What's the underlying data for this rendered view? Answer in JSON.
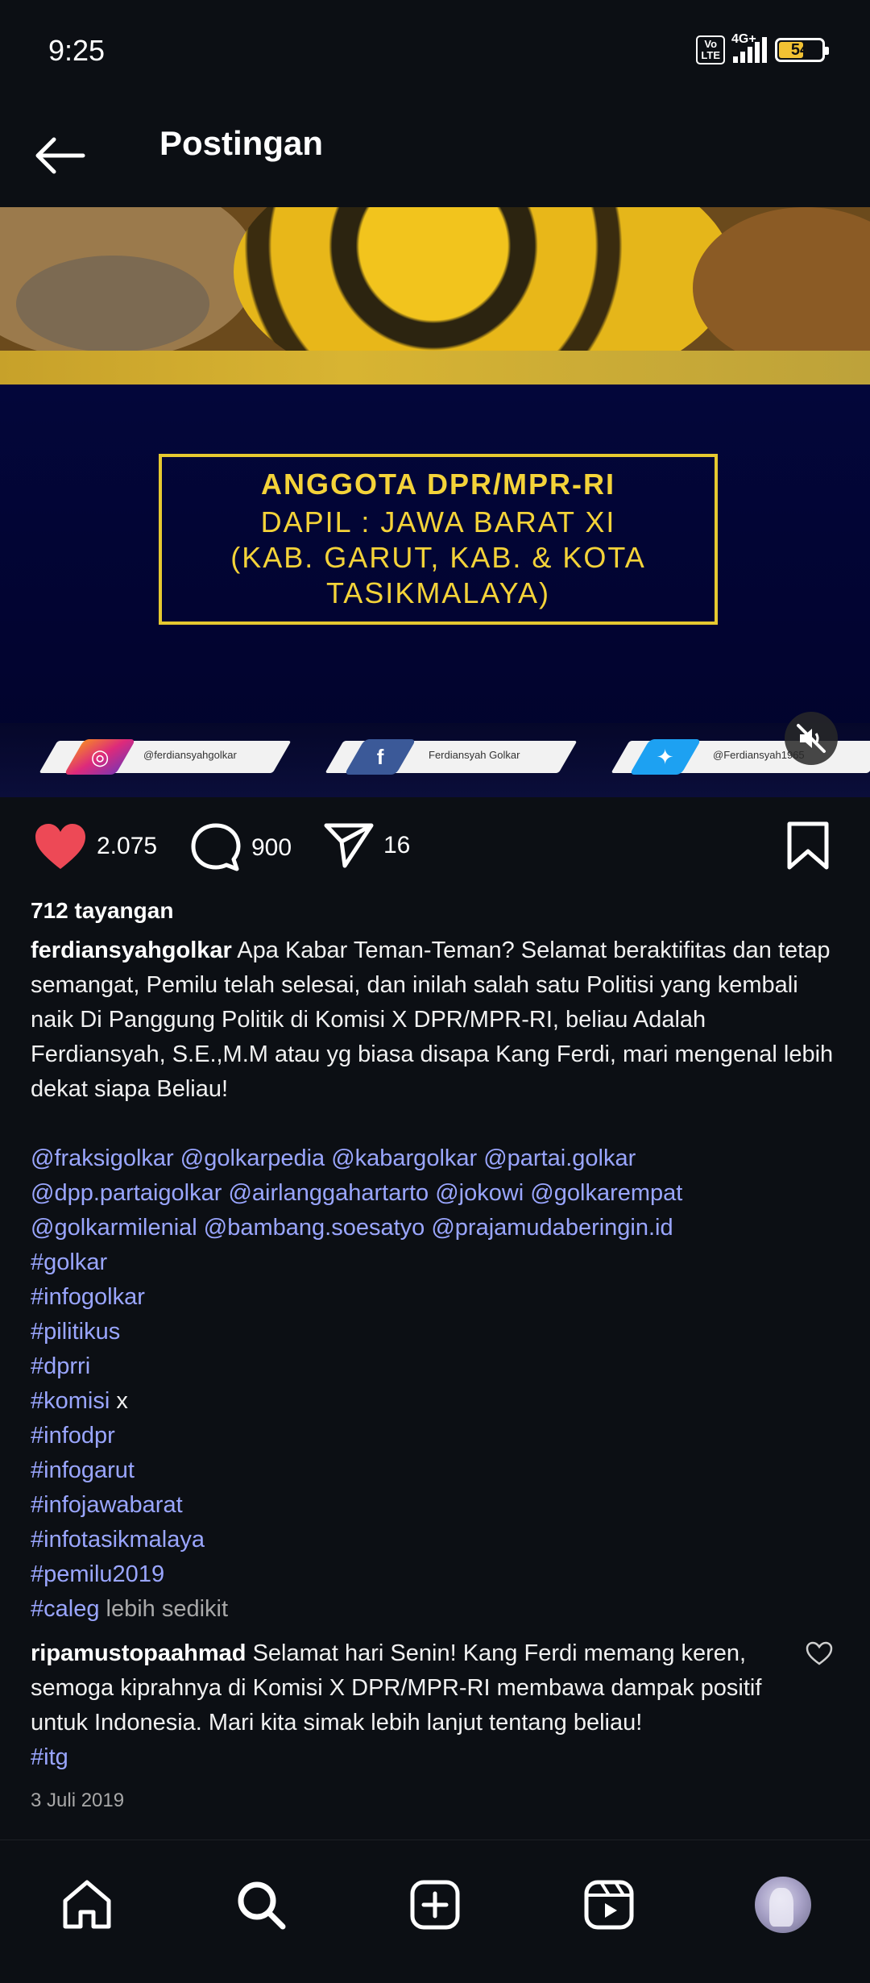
{
  "status_bar": {
    "time": "9:25",
    "volte": "Vo\nLTE",
    "network": "4G+",
    "battery": "54"
  },
  "header": {
    "title": "Postingan"
  },
  "media": {
    "caption_line1": "ANGGOTA DPR/MPR-RI",
    "caption_line2": "DAPIL : JAWA BARAT XI",
    "caption_line3": "(KAB. GARUT, KAB. & KOTA",
    "caption_line4": "TASIKMALAYA)",
    "social": {
      "instagram": "@ferdiansyahgolkar",
      "facebook": "Ferdiansyah Golkar",
      "twitter": "@Ferdiansyah1965"
    },
    "accent_color": "#f4d339",
    "box_color": "#020433"
  },
  "actions": {
    "likes": "2.075",
    "comments": "900",
    "shares": "16",
    "like_color": "#ed4956"
  },
  "post": {
    "views": "712 tayangan",
    "username": "ferdiansyahgolkar",
    "text": "Apa Kabar Teman-Teman? Selamat beraktifitas dan tetap semangat, Pemilu telah selesai, dan inilah salah satu Politisi yang kembali naik Di Panggung Politik di Komisi X DPR/MPR-RI, beliau Adalah Ferdiansyah, S.E.,M.M atau yg biasa disapa Kang Ferdi, mari mengenal lebih dekat siapa Beliau!",
    "mentions_1": "@fraksigolkar @golkarpedia @kabargolkar @partai.golkar",
    "mentions_2": "@dpp.partaigolkar @airlanggahartarto @jokowi @golkarempat",
    "mentions_3": "@golkarmilenial @bambang.soesatyo @prajamudaberingin.id",
    "hashtags": [
      "#golkar",
      "#infogolkar",
      "#pilitikus",
      "#dprri",
      "#komisi",
      "#infodpr",
      "#infogarut",
      "#infojawabarat",
      "#infotasikmalaya",
      "#pemilu2019",
      "#caleg"
    ],
    "komisi_suffix": "x",
    "more_label": "lebih sedikit",
    "link_color": "#9aa6ff"
  },
  "comment": {
    "username": "ripamustopaahmad",
    "text": "Selamat hari Senin! Kang Ferdi memang keren, semoga kiprahnya di Komisi X DPR/MPR-RI membawa dampak positif untuk Indonesia. Mari kita simak lebih lanjut tentang beliau!",
    "hashtag": "#itg"
  },
  "date": "3 Juli 2019",
  "bottom_nav": {
    "items": [
      "home-icon",
      "search-icon",
      "create-icon",
      "reels-icon",
      "profile-avatar"
    ]
  }
}
